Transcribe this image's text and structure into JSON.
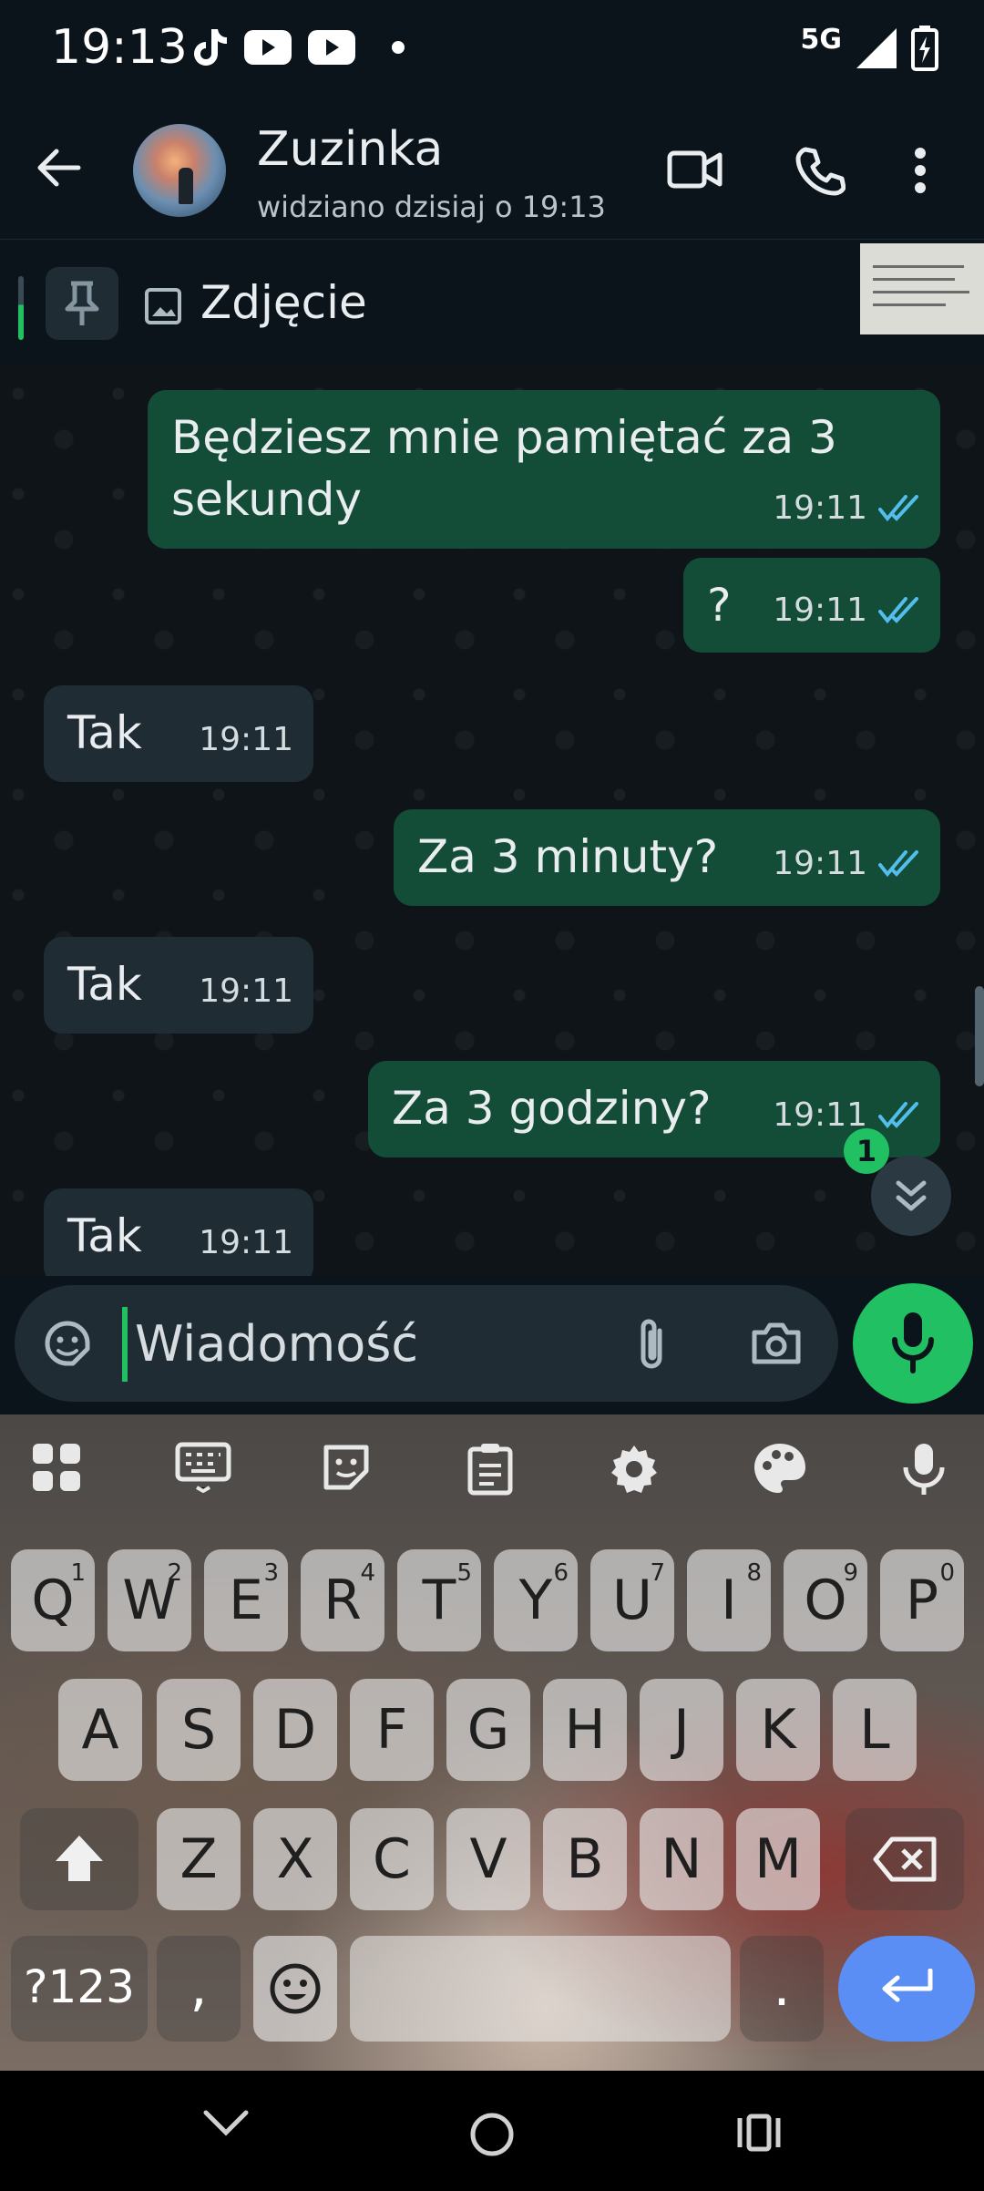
{
  "status_bar": {
    "time": "19:13",
    "network": "5G"
  },
  "header": {
    "name": "Zuzinka",
    "status": "widziano dzisiaj o 19:13"
  },
  "pinned": {
    "label": "Zdjęcie"
  },
  "messages": [
    {
      "dir": "out",
      "line1": "Będziesz mnie pamiętać za 3",
      "line2": "sekundy",
      "time": "19:11"
    },
    {
      "dir": "out",
      "text": "?",
      "time": "19:11"
    },
    {
      "dir": "in",
      "text": "Tak",
      "time": "19:11"
    },
    {
      "dir": "out",
      "text": "Za 3 minuty?",
      "time": "19:11"
    },
    {
      "dir": "in",
      "text": "Tak",
      "time": "19:11"
    },
    {
      "dir": "out",
      "text": "Za 3 godziny?",
      "time": "19:11"
    },
    {
      "dir": "in",
      "text": "Tak",
      "time": "19:11"
    }
  ],
  "unread_badge": "1",
  "composer": {
    "placeholder": "Wiadomość"
  },
  "keyboard": {
    "row1": [
      "Q",
      "W",
      "E",
      "R",
      "T",
      "Y",
      "U",
      "I",
      "O",
      "P"
    ],
    "row1_hints": [
      "1",
      "2",
      "3",
      "4",
      "5",
      "6",
      "7",
      "8",
      "9",
      "0"
    ],
    "row2": [
      "A",
      "S",
      "D",
      "F",
      "G",
      "H",
      "J",
      "K",
      "L"
    ],
    "row3": [
      "Z",
      "X",
      "C",
      "V",
      "B",
      "N",
      "M"
    ],
    "symbols_label": "?123",
    "comma": ",",
    "period": "."
  },
  "colors": {
    "accent": "#21c063",
    "outgoing_bubble": "#144d37",
    "incoming_bubble": "#1f2c34",
    "tick_read": "#53bdeb"
  }
}
